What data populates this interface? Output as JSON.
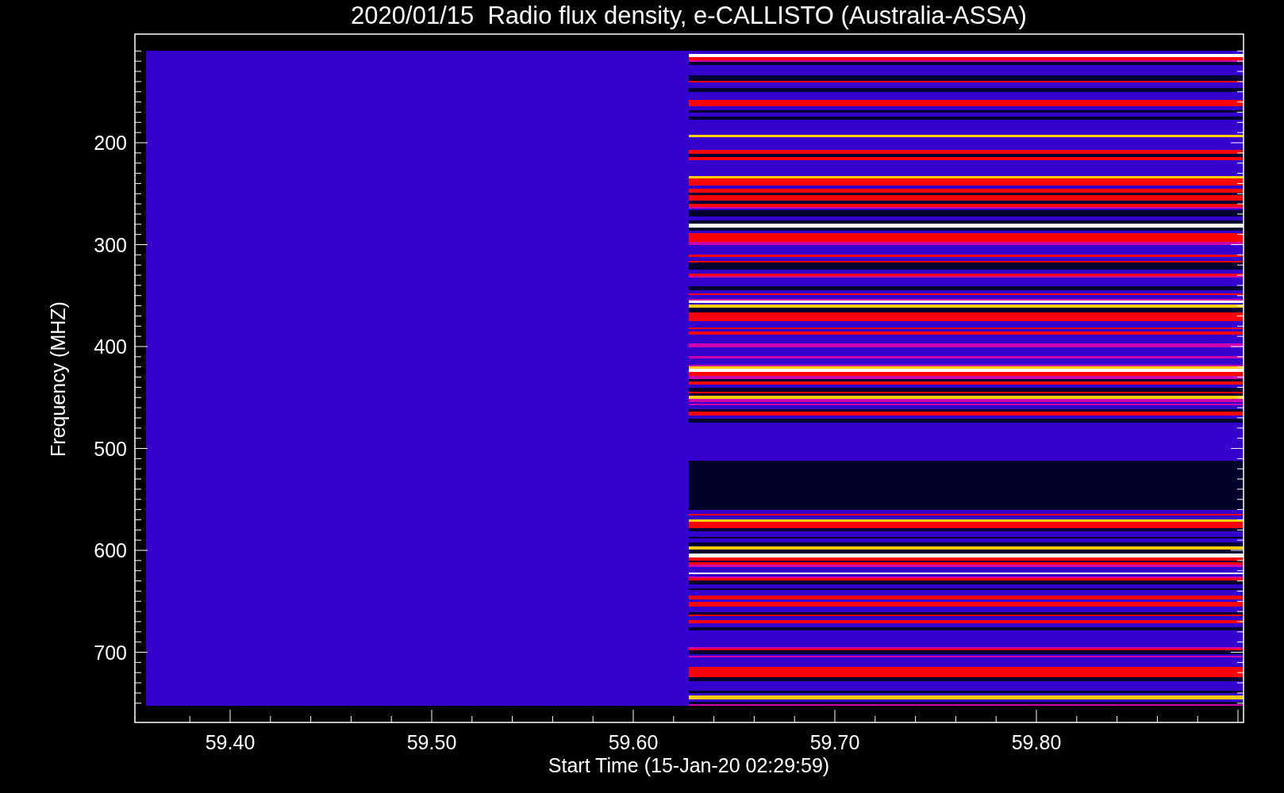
{
  "title": "2020/01/15  Radio flux density, e-CALLISTO (Australia-ASSA)",
  "y_axis": {
    "label": "Frequency (MHZ)",
    "tick_labels": [
      "200",
      "300",
      "400",
      "500",
      "600",
      "700"
    ]
  },
  "x_axis": {
    "label": "Start Time (15-Jan-20 02:29:59)",
    "tick_labels": [
      "59.40",
      "59.50",
      "59.60",
      "59.70",
      "59.80"
    ]
  }
}
